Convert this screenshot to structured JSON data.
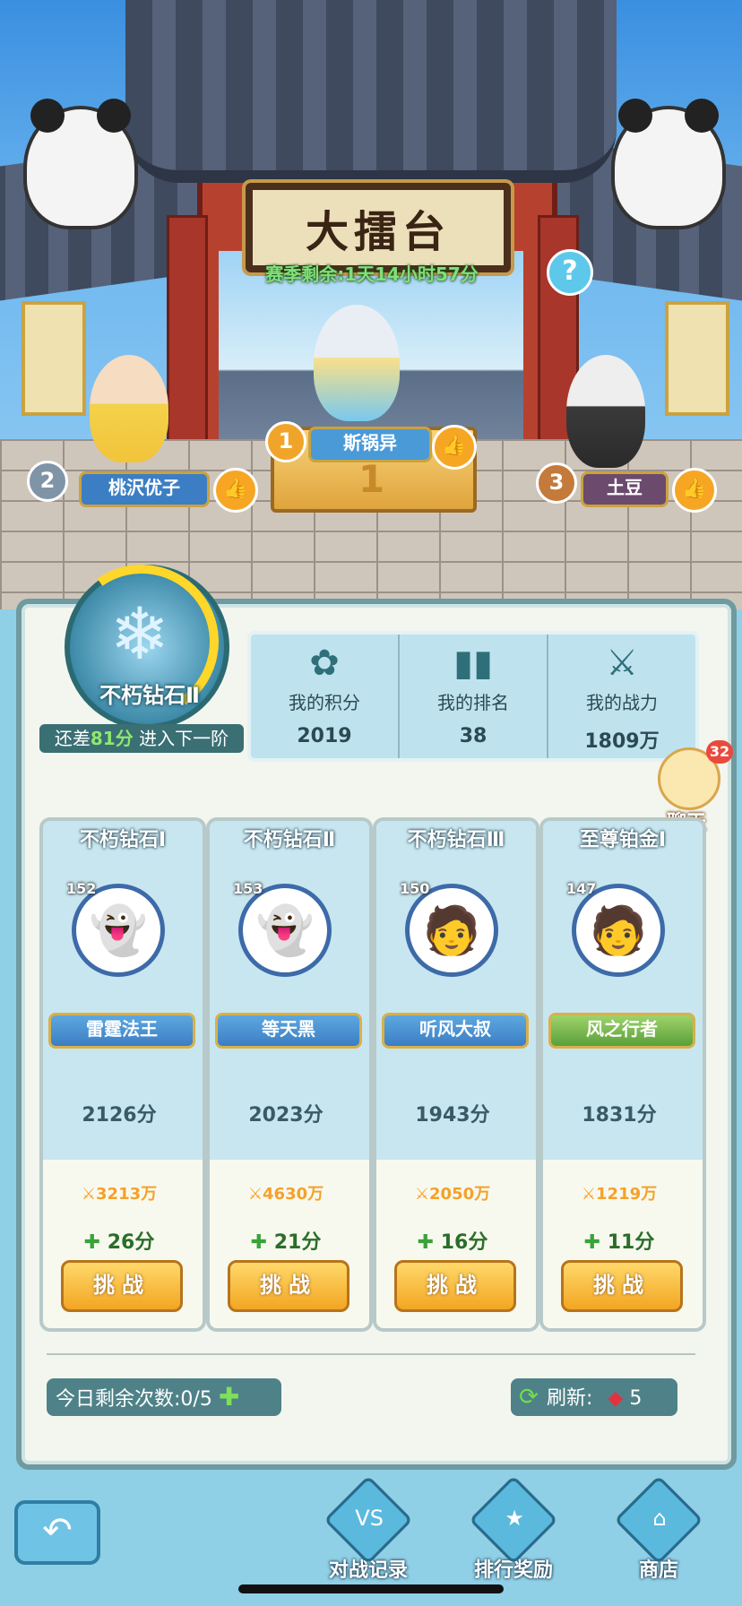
{
  "arena": {
    "title": "大擂台",
    "season_remaining": "赛季剩余:1天14小时57分",
    "help_label": "?"
  },
  "podium": [
    {
      "rank": "1",
      "name": "斯锅异",
      "podium_number": "1"
    },
    {
      "rank": "2",
      "name": "桃沢优子"
    },
    {
      "rank": "3",
      "name": "土豆"
    }
  ],
  "my_rank": {
    "tier": "不朽钻石Ⅱ",
    "next_prefix": "还差",
    "next_points": "81分",
    "next_suffix": "进入下一阶",
    "progress_fraction": 0.25
  },
  "stats": [
    {
      "label": "我的积分",
      "value": "2019",
      "icon": "score-icon"
    },
    {
      "label": "我的排名",
      "value": "38",
      "icon": "rank-bars-icon"
    },
    {
      "label": "我的战力",
      "value": "1809万",
      "icon": "crossed-swords-icon"
    }
  ],
  "chat": {
    "label": "聊天",
    "badge": "32"
  },
  "opponents": [
    {
      "tier": "不朽钻石Ⅰ",
      "level": "152",
      "name": "雷霆法王",
      "score": "2126分",
      "power": "3213万",
      "gain": "26分",
      "button": "挑战"
    },
    {
      "tier": "不朽钻石Ⅱ",
      "level": "153",
      "name": "等天黑",
      "score": "2023分",
      "power": "4630万",
      "gain": "21分",
      "button": "挑战"
    },
    {
      "tier": "不朽钻石Ⅲ",
      "level": "150",
      "name": "听风大叔",
      "score": "1943分",
      "power": "2050万",
      "gain": "16分",
      "button": "挑战"
    },
    {
      "tier": "至尊铂金Ⅰ",
      "level": "147",
      "name": "风之行者",
      "score": "1831分",
      "power": "1219万",
      "gain": "11分",
      "button": "挑战"
    }
  ],
  "footer": {
    "remaining_label": "今日剩余次数:0/5",
    "refresh_label": "刷新:",
    "refresh_cost": "5"
  },
  "nav": [
    {
      "label": "对战记录",
      "icon": "vs-icon"
    },
    {
      "label": "排行奖励",
      "icon": "medal-icon"
    },
    {
      "label": "商店",
      "icon": "shop-icon"
    }
  ],
  "colors": {
    "accent_gold": "#f2a623",
    "panel_teal": "#4f8288",
    "gain_green": "#2a6e2a",
    "power_orange": "#f5a12a"
  }
}
